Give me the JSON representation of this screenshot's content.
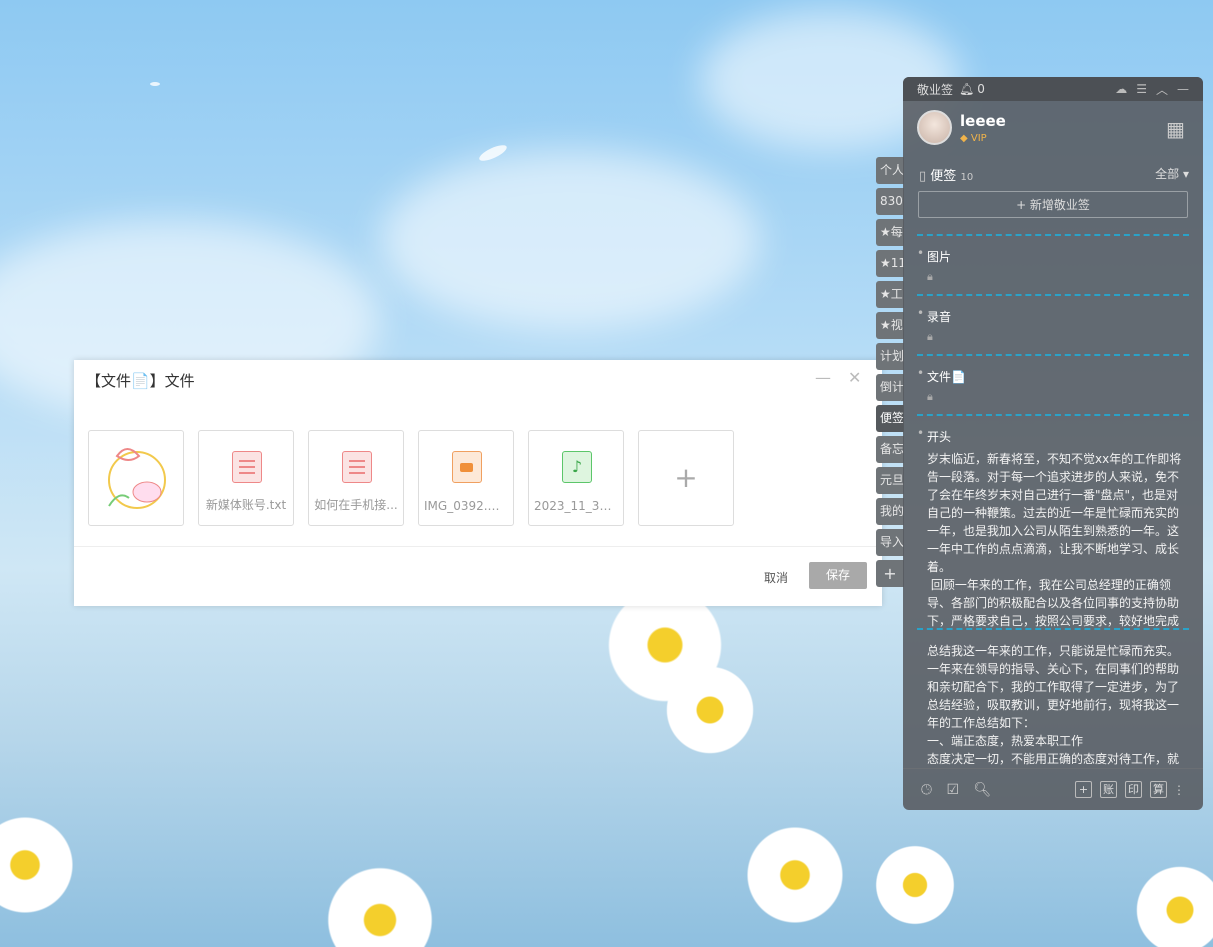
{
  "dialog": {
    "title": "【文件📄】文件",
    "minimize": "—",
    "close": "✕",
    "files": [
      {
        "name": "",
        "kind": "image"
      },
      {
        "name": "新媒体账号.txt",
        "kind": "doc"
      },
      {
        "name": "如何在手机接...",
        "kind": "doc"
      },
      {
        "name": "IMG_0392.M...",
        "kind": "video"
      },
      {
        "name": "2023_11_30_0...",
        "kind": "audio"
      }
    ],
    "add": "+",
    "cancel": "取消",
    "save": "保存"
  },
  "side_tabs": [
    "个人",
    "830",
    "★每",
    "★11",
    "★工",
    "★视",
    "计划",
    "倒计",
    "便签",
    "备忘",
    "元旦",
    "我的",
    "导入"
  ],
  "side_add": "+",
  "panel": {
    "app": "敬业签",
    "bell_count": "0",
    "user": {
      "name": "leeee",
      "badge": "VIP"
    },
    "section": {
      "title": "便签",
      "count": "10",
      "filter": "全部"
    },
    "new_button": "+ 新增敬业签",
    "notes": [
      {
        "title": "图片"
      },
      {
        "title": "录音"
      },
      {
        "title": "文件📄"
      }
    ],
    "note_long1": {
      "title": "开头",
      "body": "岁末临近，新春将至，不知不觉xx年的工作即将告一段落。对于每一个追求进步的人来说，免不了会在年终岁末对自己进行一番\"盘点\"，也是对自己的一种鞭策。过去的近一年是忙碌而充实的一年，也是我加入公司从陌生到熟悉的一年。这一年中工作的点点滴滴，让我不断地学习、成长着。\n 回顾一年来的工作，我在公司总经理的正确领导、各部门的积极配合以及各位同事的支持协助下，严格要求自己，按照公司要求，较好地完成"
    },
    "note_long2": {
      "body": "总结我这一年来的工作，只能说是忙碌而充实。一年来在领导的指导、关心下，在同事们的帮助和亲切配合下，我的工作取得了一定进步，为了总结经验，吸取教训，更好地前行，现将我这一年的工作总结如下：\n一、端正态度，热爱本职工作\n态度决定一切，不能用正确的态度对待工作，就"
    },
    "bottom_right": [
      "+",
      "账",
      "印",
      "算"
    ]
  }
}
